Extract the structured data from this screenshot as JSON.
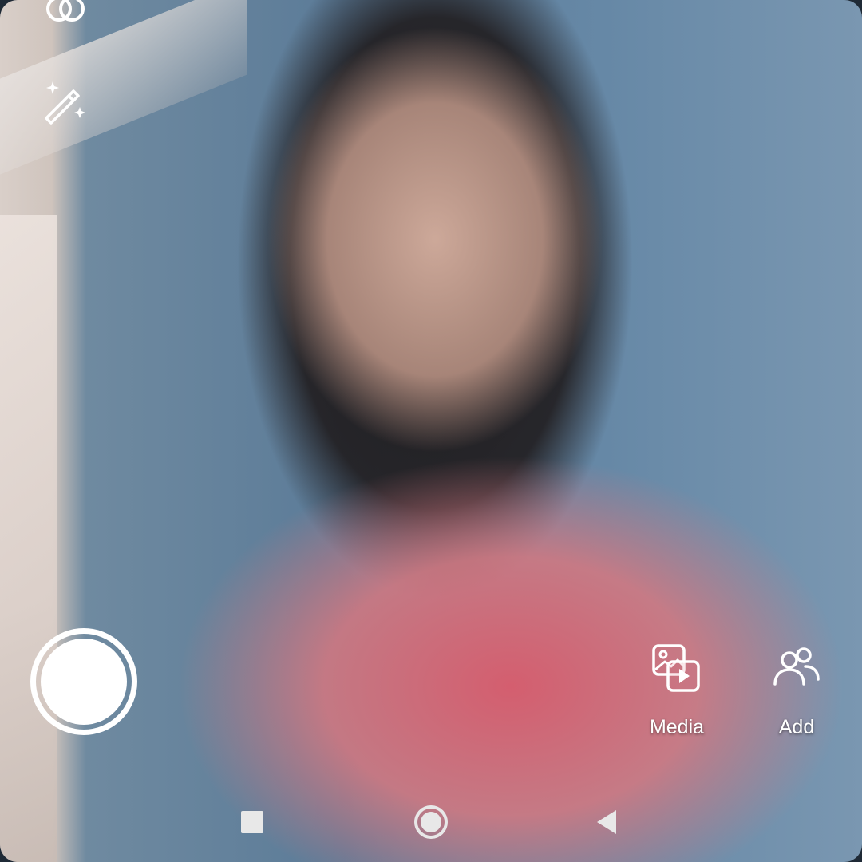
{
  "app": {
    "accent": "#ffffff"
  },
  "top_controls": {
    "items": [
      {
        "icon": "effects-icon"
      },
      {
        "icon": "magic-wand-icon"
      }
    ]
  },
  "camera": {
    "shutter_icon": "shutter-icon"
  },
  "actions": {
    "media_label": "Media",
    "media_icon": "media-gallery-icon",
    "add_label": "Add",
    "add_icon": "add-people-icon"
  },
  "navigation": {
    "recents_icon": "recents-square-icon",
    "home_icon": "home-circle-icon",
    "back_icon": "back-triangle-icon"
  }
}
